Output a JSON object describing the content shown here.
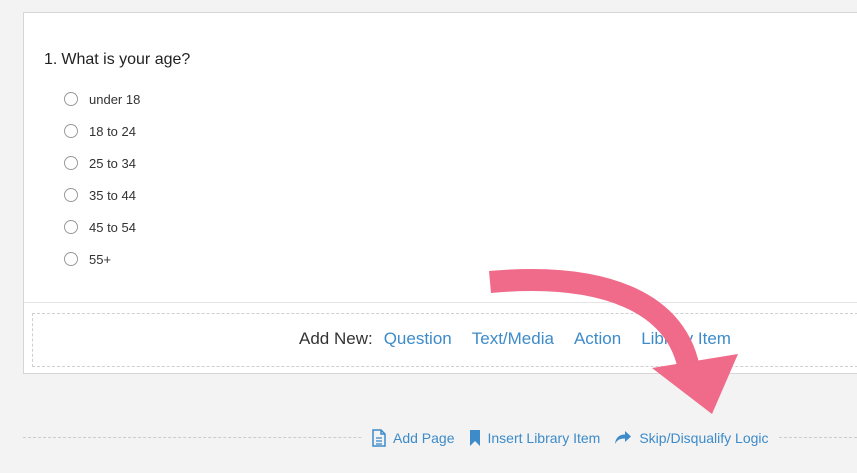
{
  "question": {
    "number": "1.",
    "title": "What is your age?",
    "options": [
      "under 18",
      "18 to 24",
      "25 to 34",
      "35 to 44",
      "45 to 54",
      "55+"
    ]
  },
  "add_new": {
    "label": "Add New:",
    "links": [
      "Question",
      "Text/Media",
      "Action",
      "Library Item"
    ]
  },
  "footer": {
    "add_page": "Add Page",
    "insert_library_item": "Insert Library Item",
    "skip_logic": "Skip/Disqualify Logic"
  },
  "colors": {
    "link": "#3d8bc9",
    "arrow": "#f06b8a",
    "background": "#f3f3f3"
  },
  "icons": [
    "document-icon",
    "bookmark-icon",
    "share-arrow-icon",
    "curved-arrow-annotation"
  ]
}
